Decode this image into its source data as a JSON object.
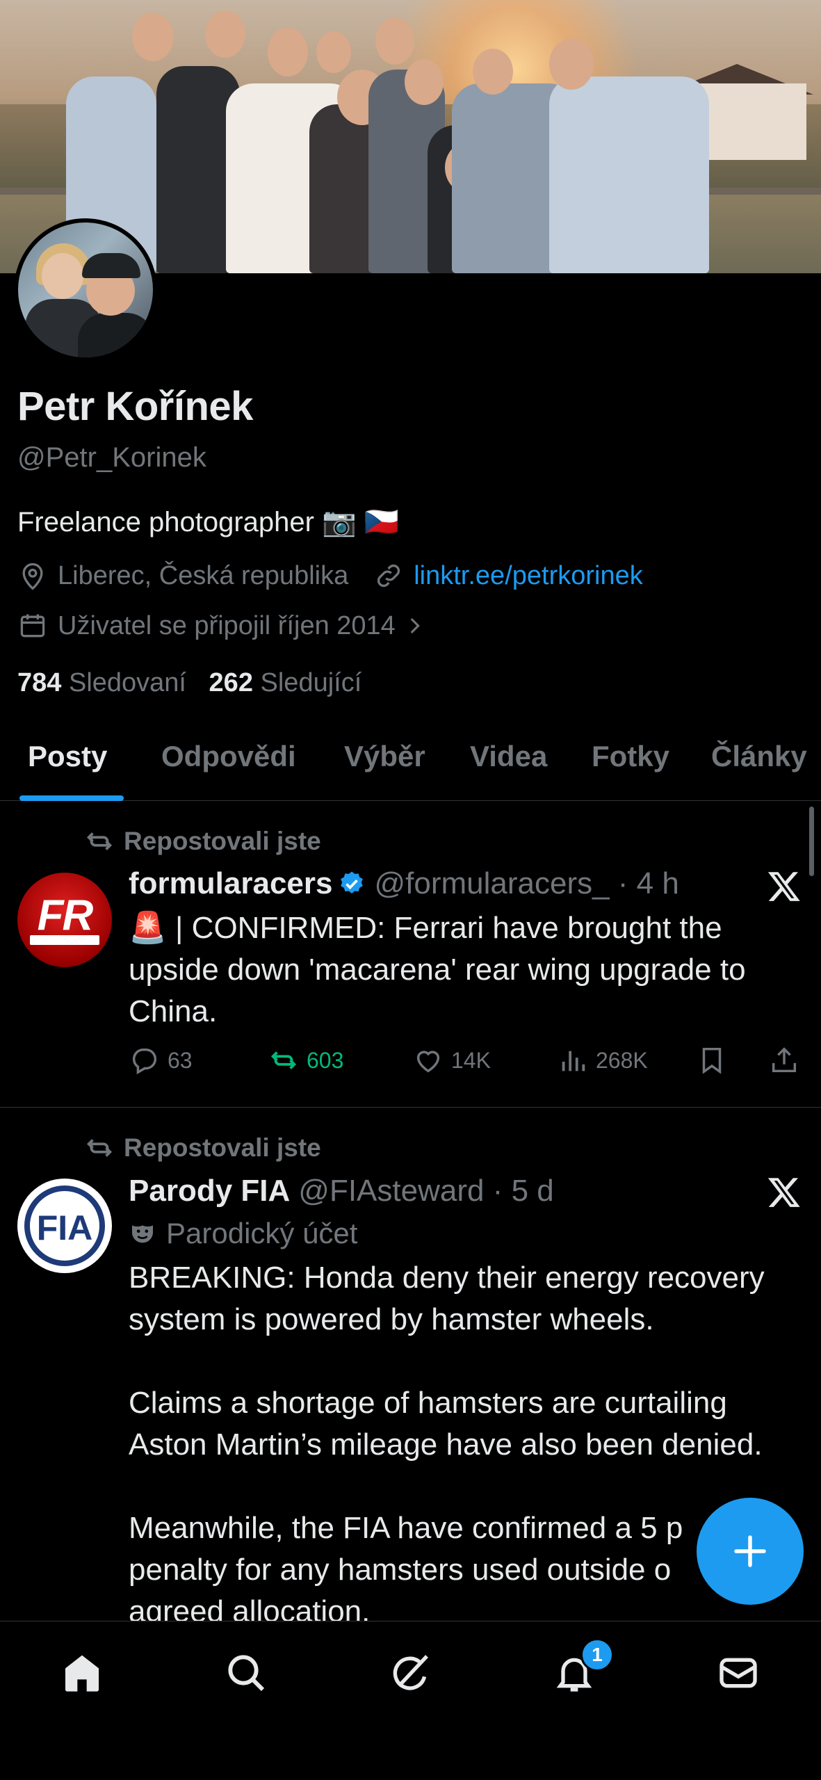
{
  "profile": {
    "name": "Petr Kořínek",
    "handle": "@Petr_Korinek",
    "bio": "Freelance photographer 📷 🇨🇿",
    "location": "Liberec, Česká republika",
    "link": "linktr.ee/petrkorinek",
    "joined": "Uživatel se připojil říjen 2014",
    "following_count": "784",
    "following_label": "Sledovaní",
    "followers_count": "262",
    "followers_label": "Sledující"
  },
  "tabs": [
    "Posty",
    "Odpovědi",
    "Výběr",
    "Videa",
    "Fotky",
    "Články"
  ],
  "posts": [
    {
      "repost_label": "Repostovali jste",
      "name": "formularacers",
      "verified": true,
      "handle": "@formularacers_ · 4 h",
      "text": "🚨 | CONFIRMED: Ferrari have brought the upside down 'macarena' rear wing upgrade to China.",
      "avatar_text": "FR",
      "replies": "63",
      "reposts": "603",
      "likes": "14K",
      "views": "268K"
    },
    {
      "repost_label": "Repostovali jste",
      "name": "Parody FIA",
      "handle": "@FIAsteward · 5 d",
      "parody_label": "Parodický účet",
      "text": "BREAKING: Honda deny their energy recovery system is powered by hamster wheels.\n\nClaims a shortage of hamsters are curtailing Aston Martin’s mileage have also been denied.\n\nMeanwhile, the FIA have confirmed a 5 p\npenalty for any hamsters used outside o\nagreed allocation.",
      "avatar_text": "FIA"
    }
  ],
  "notifications_badge": "1",
  "colors": {
    "accent": "#1d9bf0",
    "repost_green": "#00ba7c",
    "muted": "#71767b",
    "background": "#000000"
  },
  "icons": [
    "location-icon",
    "link-icon",
    "calendar-icon",
    "chevron-right-icon",
    "repost-icon",
    "verified-icon",
    "x-logo-icon",
    "reply-icon",
    "like-icon",
    "views-icon",
    "bookmark-icon",
    "share-icon",
    "parody-mask-icon",
    "compose-plus-icon",
    "home-icon",
    "search-icon",
    "grok-icon",
    "notifications-icon",
    "messages-icon"
  ]
}
